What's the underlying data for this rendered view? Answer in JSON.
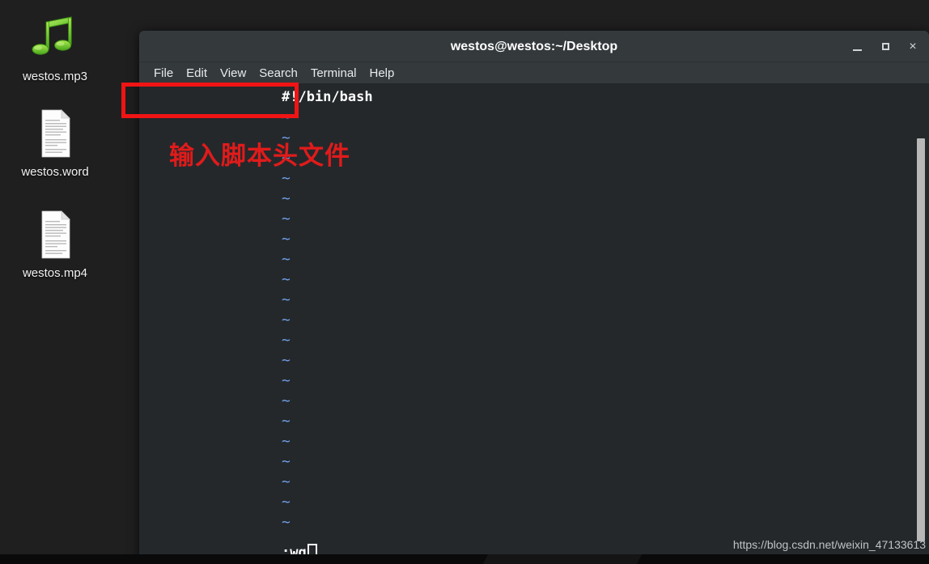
{
  "desktop": {
    "icons": [
      {
        "name": "westos.mp3",
        "icon": "music-note-icon"
      },
      {
        "name": "westos.word",
        "icon": "document-icon"
      },
      {
        "name": "westos.mp4",
        "icon": "document-icon"
      }
    ]
  },
  "terminal": {
    "title": "westos@westos:~/Desktop",
    "window_controls": {
      "minimize": "minimize-icon",
      "maximize": "maximize-icon",
      "close": "×"
    },
    "menu": [
      {
        "label": "File"
      },
      {
        "label": "Edit"
      },
      {
        "label": "View"
      },
      {
        "label": "Search"
      },
      {
        "label": "Terminal"
      },
      {
        "label": "Help"
      }
    ],
    "editor": {
      "app": "vim",
      "first_line": "#!/bin/bash",
      "empty_line_marker": "~",
      "empty_line_count": 21,
      "status_line": ":wq",
      "cursor": "block"
    }
  },
  "annotations": {
    "highlight_color": "#f01414",
    "note_text": "输入脚本头文件",
    "note_color": "#e01b1b"
  },
  "watermark": {
    "text": "https://blog.csdn.net/weixin_47133613"
  }
}
